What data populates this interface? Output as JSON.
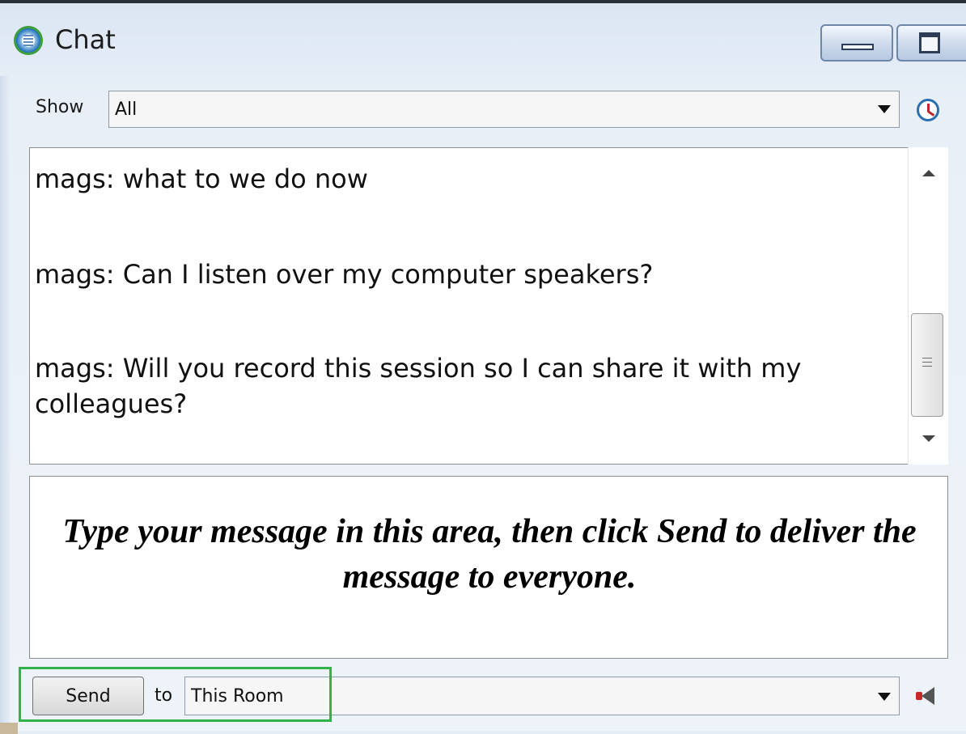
{
  "window": {
    "title": "Chat",
    "icon": "app-logo-icon",
    "controls": [
      "minimize-icon",
      "maximize-icon"
    ]
  },
  "filter": {
    "label": "Show",
    "selected": "All",
    "history_icon": "clock-icon"
  },
  "chat_log": {
    "messages": [
      "mags: what to we do now",
      "mags: Can I listen over my computer speakers?",
      "mags: Will you record this session so I can share it with my colleagues?"
    ]
  },
  "compose": {
    "instruction": "Type your message in this area, then click Send to deliver the message to everyone."
  },
  "send_bar": {
    "send_label": "Send",
    "to_label": "to",
    "recipient": "This Room",
    "speaker_icon": "megaphone-icon"
  },
  "colors": {
    "highlight": "#32b24a",
    "window_background": "#e4ecf5"
  }
}
